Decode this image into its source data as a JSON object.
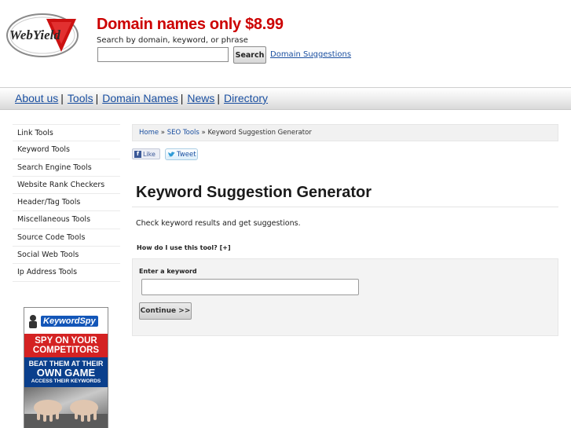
{
  "header": {
    "logo_text": "WebYield",
    "promo": "Domain names only $8.99",
    "search_hint": "Search by domain, keyword, or phrase",
    "search_value": "",
    "search_button": "Search",
    "domain_suggestions_link": "Domain Suggestions"
  },
  "nav": {
    "items": [
      "About us",
      "Tools",
      "Domain Names",
      "News",
      "Directory"
    ],
    "separator": "|"
  },
  "sidebar": {
    "items": [
      "Link Tools",
      "Keyword Tools",
      "Search Engine Tools",
      "Website Rank Checkers",
      "Header/Tag Tools",
      "Miscellaneous Tools",
      "Source Code Tools",
      "Social Web Tools",
      "Ip Address Tools"
    ]
  },
  "ad": {
    "brand": "KeywordSpy",
    "headline": "SPY ON YOUR COMPETITORS",
    "sub1": "BEAT THEM AT THEIR",
    "sub2": "OWN GAME",
    "sub3": "ACCESS THEIR KEYWORDS"
  },
  "breadcrumb": {
    "home": "Home",
    "sep": " » ",
    "section": "SEO Tools",
    "current": "Keyword Suggestion Generator"
  },
  "social": {
    "like": "Like",
    "tweet": "Tweet"
  },
  "main": {
    "title": "Keyword Suggestion Generator",
    "description": "Check keyword results and get suggestions.",
    "howto": "How do I use this tool? [+]",
    "field_label": "Enter a keyword",
    "keyword_value": "",
    "continue_button": "Continue >>"
  },
  "colors": {
    "promo_red": "#cc0000",
    "link_blue": "#1a4fa0"
  }
}
